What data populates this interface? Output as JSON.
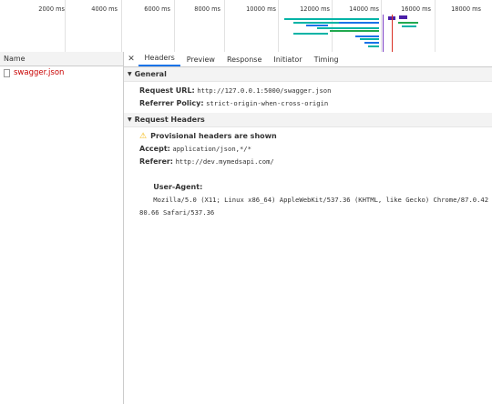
{
  "timeline": {
    "ticks": [
      "2000 ms",
      "4000 ms",
      "6000 ms",
      "8000 ms",
      "10000 ms",
      "12000 ms",
      "14000 ms",
      "16000 ms",
      "18000 ms"
    ]
  },
  "request_list": {
    "header": "Name",
    "items": [
      {
        "name": "swagger.json"
      }
    ]
  },
  "tabs": [
    "Headers",
    "Preview",
    "Response",
    "Initiator",
    "Timing"
  ],
  "general": {
    "title": "General",
    "request_url_label": "Request URL:",
    "request_url": "http://127.0.0.1:5000/swagger.json",
    "referrer_policy_label": "Referrer Policy:",
    "referrer_policy": "strict-origin-when-cross-origin"
  },
  "request_headers": {
    "title": "Request Headers",
    "provisional": "Provisional headers are shown",
    "accept_label": "Accept:",
    "accept": "application/json,*/*",
    "referer_label": "Referer:",
    "referer": "http://dev.mymedsapi.com/",
    "user_agent_label": "User-Agent:",
    "user_agent": "Mozilla/5.0 (X11; Linux x86_64) AppleWebKit/537.36 (KHTML, like Gecko) Chrome/87.0.4280.66 Safari/537.36"
  },
  "colors": {
    "accent": "#1a73e8",
    "error_name": "#c80000",
    "bar_teal": "#00b3a6",
    "bar_blue": "#1a73e8",
    "bar_purple": "#4b1fa8",
    "bar_green": "#22a94f",
    "marker_red": "#d93025",
    "marker_purple": "#7b3fc4"
  }
}
